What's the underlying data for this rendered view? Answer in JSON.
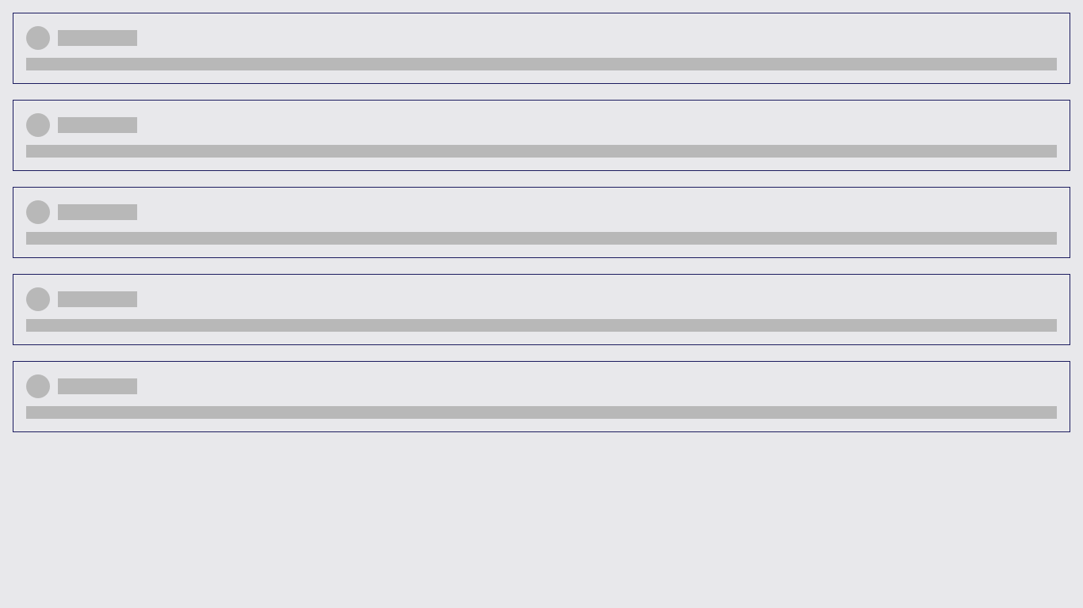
{
  "colors": {
    "background": "#e8e8eb",
    "card_border": "#1a1a5e",
    "placeholder": "#b8b8b8"
  },
  "state": "loading",
  "cards": [
    {
      "avatar": "placeholder",
      "title": "placeholder",
      "body": "placeholder"
    },
    {
      "avatar": "placeholder",
      "title": "placeholder",
      "body": "placeholder"
    },
    {
      "avatar": "placeholder",
      "title": "placeholder",
      "body": "placeholder"
    },
    {
      "avatar": "placeholder",
      "title": "placeholder",
      "body": "placeholder"
    },
    {
      "avatar": "placeholder",
      "title": "placeholder",
      "body": "placeholder"
    }
  ]
}
